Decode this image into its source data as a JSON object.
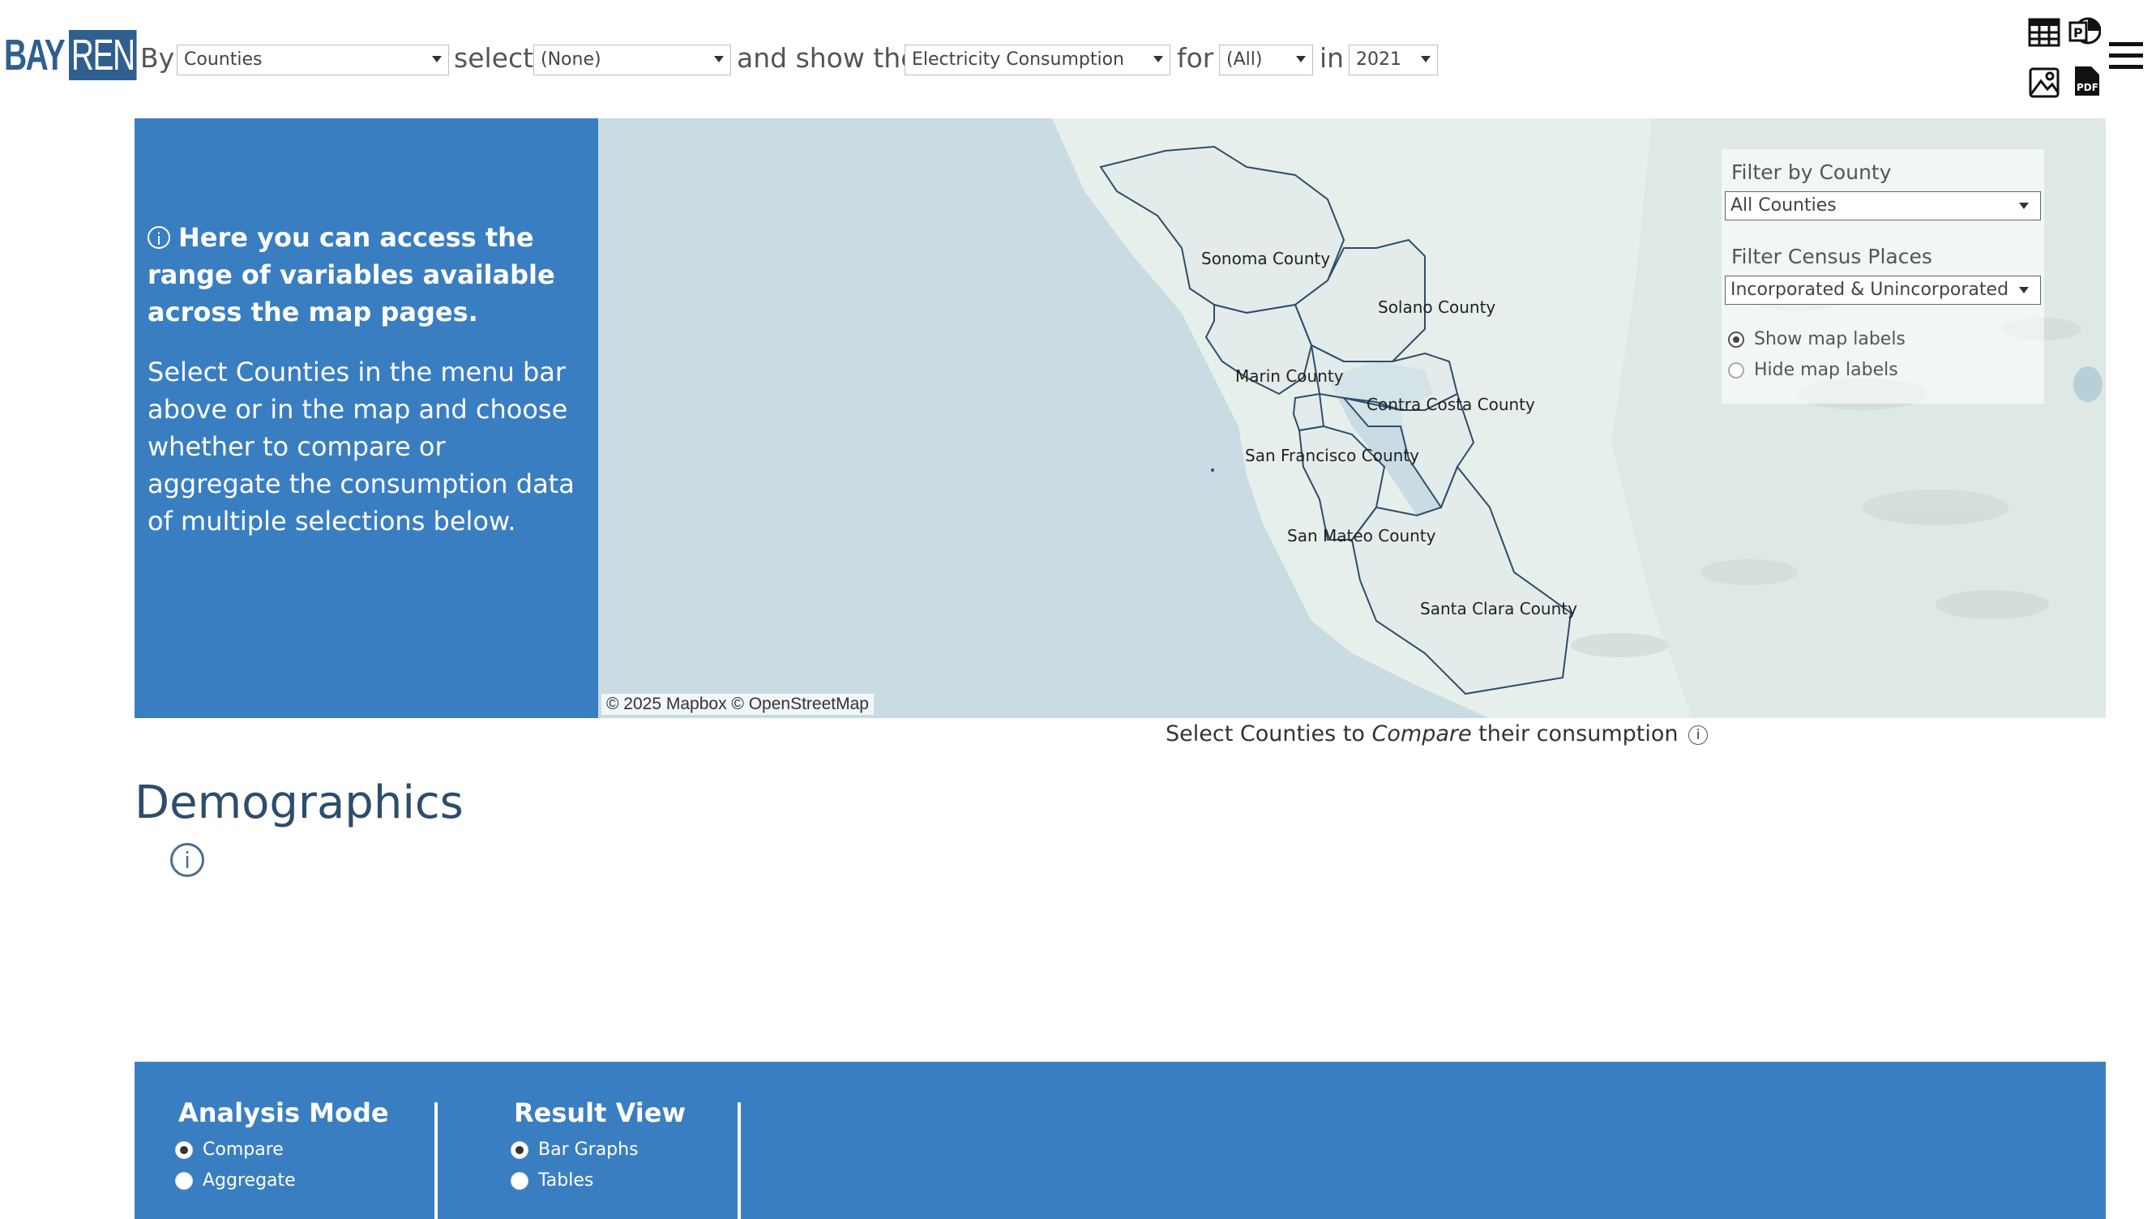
{
  "logo": {
    "bay": "BAY",
    "ren": "REN"
  },
  "toolbar": {
    "by_label": "By",
    "by_value": "Counties",
    "select_label": "select",
    "select_value": "(None)",
    "show_label": "and show the",
    "show_value": "Electricity Consumption",
    "for_label": "for",
    "for_value": "(All)",
    "in_label": "in",
    "in_value": "2021"
  },
  "icons": {
    "table": "table-icon",
    "powerpoint": "powerpoint-icon",
    "image": "image-icon",
    "pdf": "pdf-icon",
    "menu": "hamburger-menu-icon"
  },
  "info_panel": {
    "bold_text": "Here you can access the range of variables available across the map pages.",
    "body_text": "Select Counties in the menu bar above or in the map and choose whether to compare or aggregate the consumption data of multiple selections below."
  },
  "map": {
    "counties": [
      "Sonoma County",
      "Solano County",
      "Marin County",
      "Contra Costa County",
      "San Francisco County",
      "San Mateo County",
      "Santa Clara County"
    ],
    "attribution": "© 2025 Mapbox  © OpenStreetMap",
    "filters": {
      "county_title": "Filter by County",
      "county_value": "All Counties",
      "census_title": "Filter Census Places",
      "census_value": "Incorporated & Unincorporated",
      "show_labels": "Show map labels",
      "hide_labels": "Hide map labels"
    }
  },
  "caption": {
    "prefix": "Select Counties to ",
    "emph": "Compare",
    "suffix": " their consumption"
  },
  "demographics": {
    "title": "Demographics"
  },
  "bottom": {
    "analysis_title": "Analysis Mode",
    "analysis_options": [
      "Compare",
      "Aggregate"
    ],
    "result_title": "Result View",
    "result_options": [
      "Bar Graphs",
      "Tables"
    ]
  },
  "colors": {
    "accent": "#3a7ec2",
    "water": "#c9dce4",
    "land": "#e6efea",
    "heading": "#2d4d6b"
  }
}
